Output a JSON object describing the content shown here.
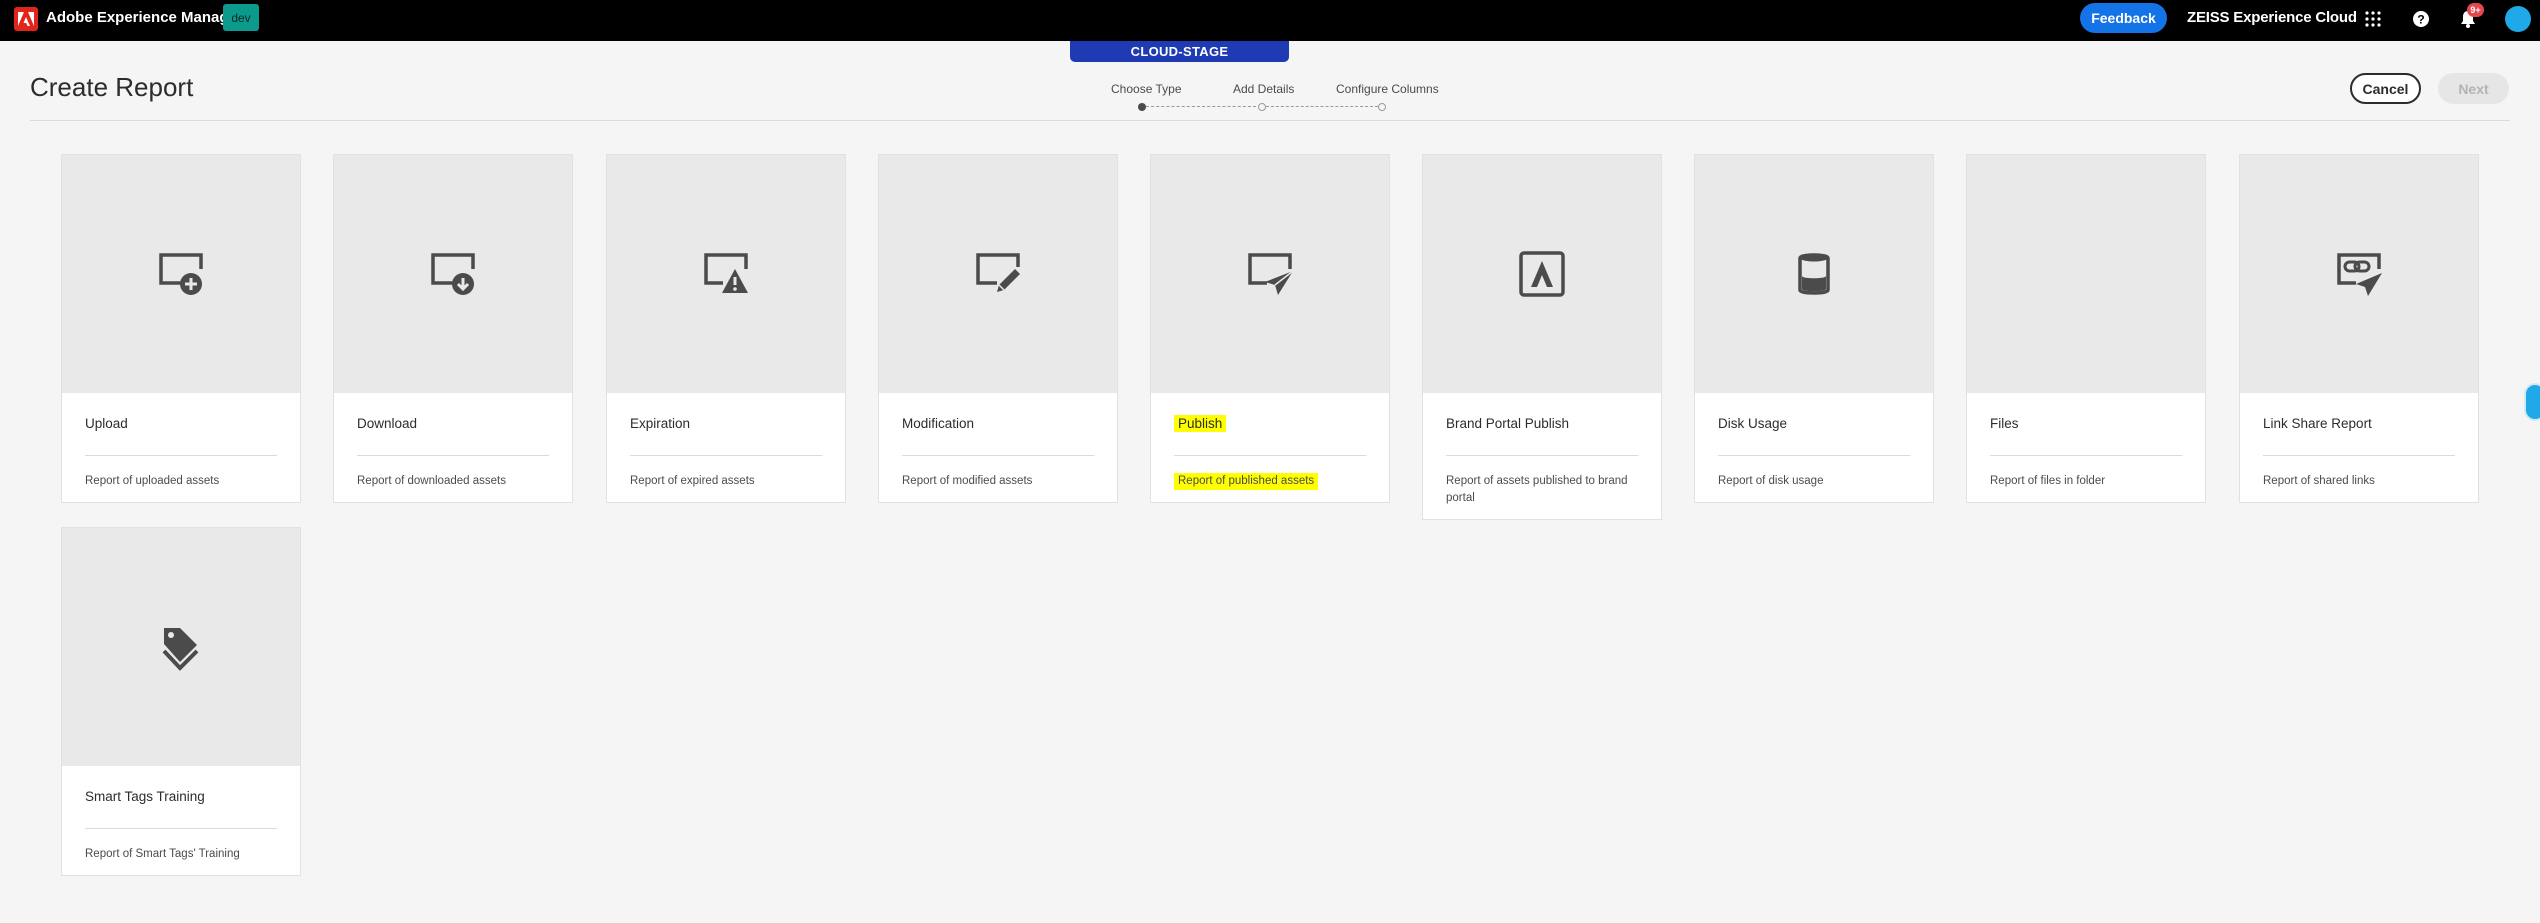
{
  "shell": {
    "app_title": "Adobe Experience Manager",
    "env_badge": "dev",
    "feedback_label": "Feedback",
    "org_name": "ZEISS Experience Cloud",
    "notification_count": "9+"
  },
  "stage_tag": "CLOUD-STAGE",
  "header": {
    "title": "Create Report",
    "cancel_label": "Cancel",
    "next_label": "Next"
  },
  "wizard": {
    "steps": [
      {
        "label": "Choose Type",
        "active": true
      },
      {
        "label": "Add Details",
        "active": false
      },
      {
        "label": "Configure Columns",
        "active": false
      }
    ]
  },
  "cards": [
    {
      "title": "Upload",
      "description": "Report of uploaded assets",
      "icon": "upload-report-icon"
    },
    {
      "title": "Download",
      "description": "Report of downloaded assets",
      "icon": "download-report-icon"
    },
    {
      "title": "Expiration",
      "description": "Report of expired assets",
      "icon": "expiration-report-icon"
    },
    {
      "title": "Modification",
      "description": "Report of modified assets",
      "icon": "modification-report-icon"
    },
    {
      "title": "Publish",
      "description": "Report of published assets",
      "icon": "publish-report-icon",
      "highlighted": true
    },
    {
      "title": "Brand Portal Publish",
      "description": "Report of assets published to brand portal",
      "icon": "brand-portal-icon"
    },
    {
      "title": "Disk Usage",
      "description": "Report of disk usage",
      "icon": "disk-usage-icon"
    },
    {
      "title": "Files",
      "description": "Report of files in folder",
      "icon": "files-report-icon"
    },
    {
      "title": "Link Share Report",
      "description": "Report of shared links",
      "icon": "link-share-icon"
    },
    {
      "title": "Smart Tags Training",
      "description": "Report of Smart Tags' Training",
      "icon": "smart-tags-icon"
    }
  ],
  "colors": {
    "highlight": "#ffff00",
    "feedback": "#1473e6",
    "stage": "#1f3bb3",
    "env_badge": "#0b9a8c"
  }
}
